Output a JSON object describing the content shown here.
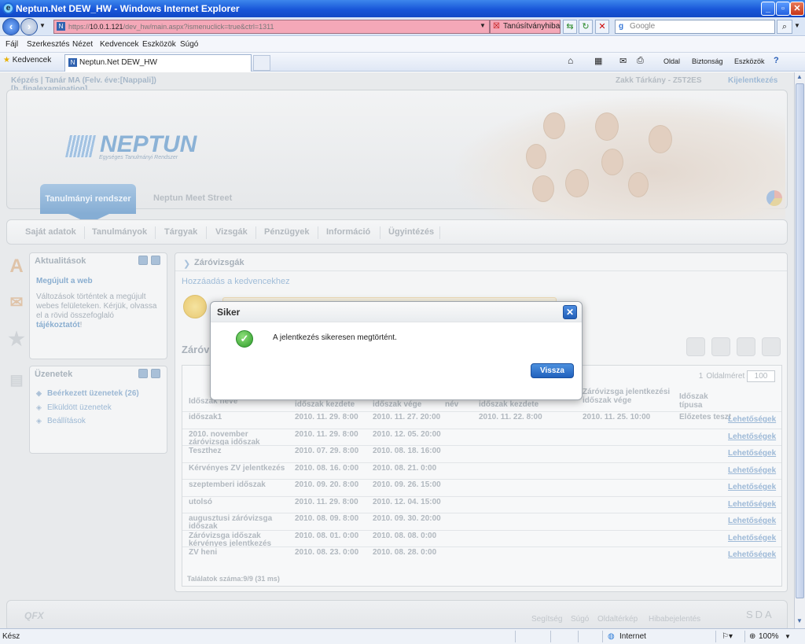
{
  "window": {
    "title": "Neptun.Net DEW_HW - Windows Internet Explorer"
  },
  "address": {
    "url_prefix": "https://",
    "url_host": "10.0.1.121",
    "url_rest": "/dev_hw/main.aspx?ismenuclick=true&ctrl=1311",
    "cert_error": "Tanúsítványhiba",
    "search_placeholder": "Google"
  },
  "menu": [
    "Fájl",
    "Szerkesztés",
    "Nézet",
    "Kedvencek",
    "Eszközök",
    "Súgó"
  ],
  "favbar": {
    "favorites": "Kedvencek",
    "tab_title": "Neptun.Net DEW_HW",
    "commands": [
      "Oldal",
      "Biztonság",
      "Eszközök"
    ]
  },
  "page": {
    "breadcrumb": "Képzés | Tanár MA (Felv. éve:[Nappali]) [h_finalexamination]",
    "user": "Zakk Tárkány - Z5T2ES",
    "logout": "Kijelentkezés",
    "logo": "NEPTUN",
    "logo_sub": "Egységes Tanulmányi Rendszer",
    "tab_active": "Tanulmányi rendszer",
    "tab_other": "Neptun Meet Street",
    "nav": [
      "Saját adatok",
      "Tanulmányok",
      "Tárgyak",
      "Vizsgák",
      "Pénzügyek",
      "Információ",
      "Ügyintézés"
    ],
    "news": {
      "title": "Aktualitások",
      "headline": "Megújult a web",
      "body": "Változások történtek a megújult webes felületeken. Kérjük, olvassa el a rövid összefoglaló ",
      "link": "tájékoztatót",
      "tail": "!"
    },
    "messages": {
      "title": "Üzenetek",
      "items": [
        "Beérkezett üzenetek (26)",
        "Elküldött üzenetek",
        "Beállítások"
      ]
    },
    "main": {
      "title": "Záróvizsgák",
      "add_fav": "Hozzáadás a kedvencekhez",
      "subtitle": "Záróvi",
      "page_size_label": "Oldalméret",
      "page_size": "100",
      "page_num": "1",
      "headers": [
        "Időszak neve",
        "időszak kezdete",
        "időszak vége",
        "név",
        "időszak kezdete",
        "Záróvizsga jelentkezési időszak vége",
        "Időszak típusa"
      ],
      "rows": [
        [
          "időszak1",
          "2010. 11. 29. 8:00",
          "2010. 11. 27. 20:00",
          "",
          "2010. 11. 22. 8:00",
          "2010. 11. 25. 10:00",
          "Előzetes teszt"
        ],
        [
          "2010. november záróvizsga időszak",
          "2010. 11. 29. 8:00",
          "2010. 12. 05. 20:00",
          "",
          "",
          "",
          ""
        ],
        [
          "Teszthez",
          "2010. 07. 29. 8:00",
          "2010. 08. 18. 16:00",
          "",
          "",
          "",
          ""
        ],
        [
          "Kérvényes ZV jelentkezés",
          "2010. 08. 16. 0:00",
          "2010. 08. 21. 0:00",
          "",
          "",
          "",
          ""
        ],
        [
          "szeptemberi időszak",
          "2010. 09. 20. 8:00",
          "2010. 09. 26. 15:00",
          "",
          "",
          "",
          ""
        ],
        [
          "utolsó",
          "2010. 11. 29. 8:00",
          "2010. 12. 04. 15:00",
          "",
          "",
          "",
          ""
        ],
        [
          "augusztusi záróvizsga időszak",
          "2010. 08. 09. 8:00",
          "2010. 09. 30. 20:00",
          "",
          "",
          "",
          ""
        ],
        [
          "Záróvizsga időszak kérvényes jelentkezés",
          "2010. 08. 01. 0:00",
          "2010. 08. 08. 0:00",
          "",
          "",
          "",
          ""
        ],
        [
          "ZV heni",
          "2010. 08. 23. 0:00",
          "2010. 08. 28. 0:00",
          "",
          "",
          "",
          ""
        ]
      ],
      "row_link": "Lehetőségek",
      "result_count": "Találatok száma:9/9 (31 ms)"
    },
    "footer": {
      "links": [
        "Segítség",
        "Súgó",
        "Oldaltérkép",
        "Hibabejelentés"
      ],
      "left_logo": "QFX",
      "right_logo": "SDA"
    }
  },
  "dialog": {
    "title": "Siker",
    "message": "A jelentkezés sikeresen megtörtént.",
    "button": "Vissza"
  },
  "status": {
    "left": "Kész",
    "zone": "Internet",
    "zoom": "100%"
  }
}
